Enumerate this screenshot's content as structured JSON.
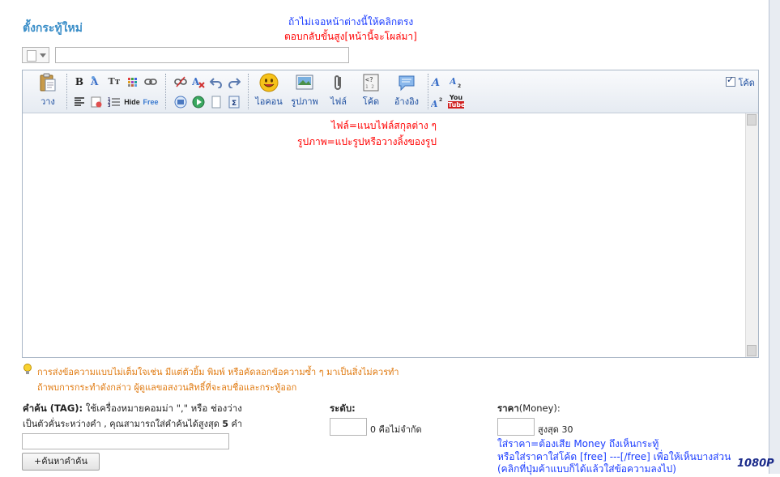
{
  "page": {
    "title": "ตั้งกระทู้ใหม่"
  },
  "annotations": {
    "top_line1": "ถ้าไม่เจอหน้าต่างนี้ให้คลิกตรง",
    "top_line2": "ตอบกลับขั้นสูง[หน้านี้จะโผล่มา]",
    "mid_line1": "ไฟล์=แนบไฟล์สกุลต่าง ๆ",
    "mid_line2": "รูปภาพ=แปะรูปหรือวางลิ้งของรูป",
    "bottom_line1": "ใส่ราคา=ต้องเสีย Money ถึงเห็นกระทู้",
    "bottom_line2": "หรือใส่ราคาใส่โค้ด [free] ---[/free] เพื่อให้เห็นบางส่วน",
    "bottom_line3": "(คลิกที่ปุ่มค้าแบบก็ได้แล้วใส่ข้อความลงไป)"
  },
  "form": {
    "title_input_value": "",
    "prefix_icon": "document-icon"
  },
  "toolbar": {
    "paste_label": "วาง",
    "emoji_label": "ไอคอน",
    "image_label": "รูปภาพ",
    "file_label": "ไฟล์",
    "code_label": "โค้ด",
    "quote_label": "อ้างอิง",
    "code_mode_label": "โค้ด",
    "code_mode_checked": true,
    "hide_label": "Hide",
    "free_label": "Free",
    "bold_label": "B",
    "font_size_label": "Tт",
    "youtube_label_top": "You",
    "youtube_label_bottom": "Tube"
  },
  "warning": {
    "line1": "การส่งข้อความแบบไม่เต็มใจเช่น มีแต่ตัวยิ้ม พิมพ์ หรือคัดลอกข้อความซ้ำ ๆ มาเป็นสิ่งไม่ควรทำ",
    "line2": "ถ้าพบการกระทำดังกล่าว ผู้ดูแลขอสงวนสิทธิ์ที่จะลบชื่อและกระทู้ออก"
  },
  "tags": {
    "label": "คำค้น (TAG):",
    "help1": "ใช้เครื่องหมายคอมม่า \",\" หรือ ช่องว่าง",
    "help2_prefix": "เป็นตัวคั่นระหว่างคำ , คุณสามารถใส่คำค้นได้สูงสุด",
    "help2_max": "5",
    "help2_suffix": "คำ",
    "input_value": "",
    "button_label": "+ค้นหาคำค้น"
  },
  "level": {
    "label": "ระดับ:",
    "value": "",
    "hint": "0 คือไม่จำกัด"
  },
  "price": {
    "label_bold": "ราคา",
    "label_rest": "(Money):",
    "value": "",
    "hint": "สูงสุด 30"
  },
  "watermark": "1080P",
  "colors": {
    "title": "#3a8ec8",
    "blue_note": "#1a3cff",
    "red_note": "#ff0000",
    "warning": "#e07a10",
    "toolbar_label": "#1e4fa0"
  }
}
